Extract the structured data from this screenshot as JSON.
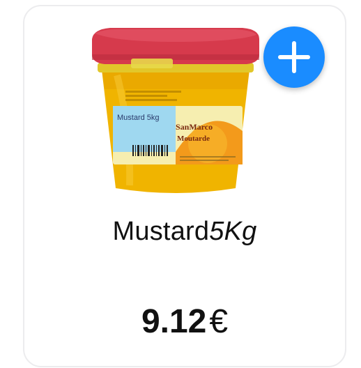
{
  "product": {
    "name_main": "Mustard",
    "name_unit": "5Kg",
    "price_amount": "9.12",
    "price_currency": "€",
    "label": {
      "product_line": "Mustard 5kg",
      "brand": "SanMarco",
      "variety": "Moutarde"
    }
  },
  "actions": {
    "add_icon": "plus-icon"
  },
  "colors": {
    "accent": "#1a8cff",
    "bucket_body": "#f0b400",
    "bucket_lid": "#d8384a"
  }
}
